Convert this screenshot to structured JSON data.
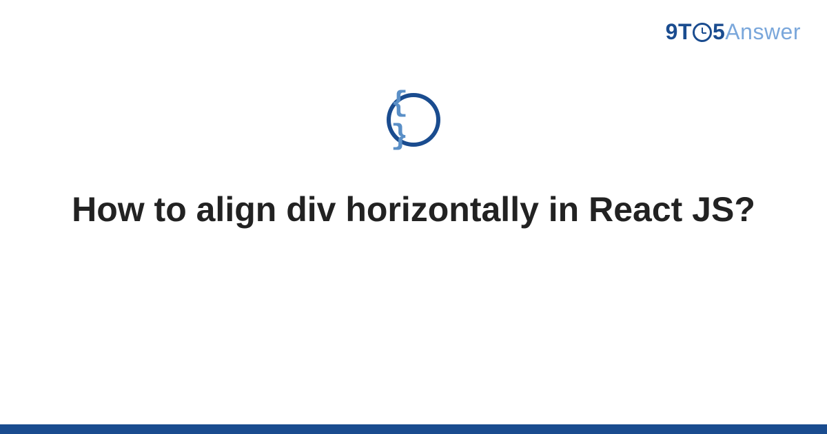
{
  "logo": {
    "part1": "9T",
    "part2": "5",
    "part3": "Answer"
  },
  "icon": {
    "name": "code-braces-icon",
    "symbol": "{ }"
  },
  "title": "How to align div horizontally in React JS?",
  "colors": {
    "primary": "#1a4c8f",
    "secondary": "#7aa7db",
    "icon_braces": "#5a8fc7",
    "text": "#222222"
  }
}
